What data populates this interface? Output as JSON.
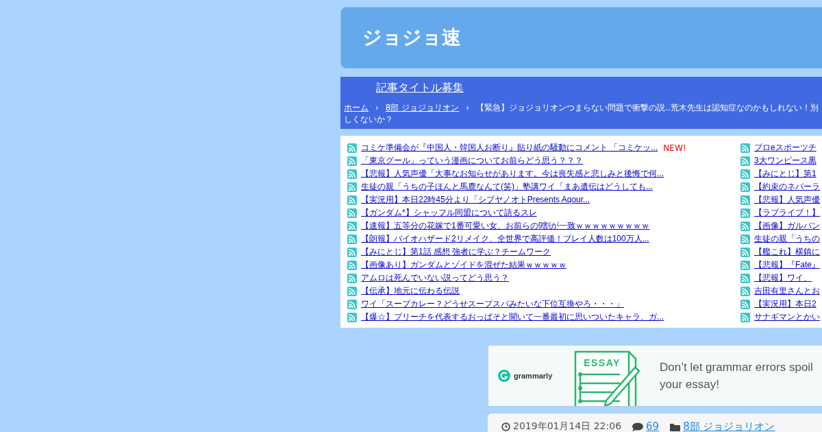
{
  "site": {
    "title": "ジョジョ速"
  },
  "nav": {
    "link": "記事タイトル募集"
  },
  "breadcrumb": {
    "separator": "›",
    "items": [
      "ホーム",
      "8部 ジョジョリオン"
    ],
    "current_lines": [
      "【緊急】ジョジョリオンつまらない問題で衝撃の説‥荒木先生は認知症なのかもしれない！別",
      "しくないか？"
    ]
  },
  "feeds_left": [
    {
      "title": "コミケ準備会が『中国人・韓国人お断り』貼り紙の騒動にコメント 「コミケッ...",
      "badge": "NEW!"
    },
    {
      "title": "「東京グール」っていう漫画についてお前らどう思う？？？"
    },
    {
      "title": "【悲報】人気声優「大事なお知らせがあります。今は喪失感と悲しみと後悔で何..."
    },
    {
      "title": "生徒の親「うちの子ほんと馬鹿なんて(笑)」塾講ワイ「まあ遺伝はどうしても..."
    },
    {
      "title": "【実況用】本日22時45分より「シブヤノオトPresents Aqour..."
    },
    {
      "title": "【ガンダム*】シャッフル同盟について語るスレ"
    },
    {
      "title": "【速報】五等分の花嫁で1番可愛い女、お前らの9割が一致ｗｗｗｗｗｗｗｗｗ"
    },
    {
      "title": "【朗報】バイオハザード2リメイク、全世界で高評価！プレイ人数は100万人..."
    },
    {
      "title": "【みにとじ】第1話 感想 強者に学ぶ？チームワーク"
    },
    {
      "title": "【画像あり】ガンダムとゾイドを混ぜた結果ｗｗｗｗｗ"
    },
    {
      "title": "アムロは死んでいない説ってどう思う？"
    },
    {
      "title": "【伝承】地元に伝わる伝説"
    },
    {
      "title": "ワイ「スープカレー？どうせスープスパみたいな下位互換やろ・・・」"
    },
    {
      "title": "【爆☆】ブリーチを代表するおっぱそと聞いて一番最初に思いついたキャラ、ガ..."
    }
  ],
  "feeds_right": [
    "プロeスポーツチ",
    "3大ワンピース黒",
    "【みにとじ】第1",
    "【約束のネバーラ",
    "【悲報】人気声優",
    "【ラブライブ！】",
    "【画像】ガルパン",
    "生徒の親「うちの",
    "【艦これ】横鎮に",
    "【悲報】『Fate』",
    "【悲報】ワイ、",
    "吉田有里さんとお",
    "【実況用】本日2",
    "サナギマンとかい"
  ],
  "ad": {
    "brand": "grammarly",
    "illustration_word": "ESSAY",
    "text": "Don’t let grammar errors spoil your essay!"
  },
  "post_meta": {
    "date": "2019年01月14日 22:06",
    "comments": "69",
    "category": "8部 ジョジョリオン"
  }
}
